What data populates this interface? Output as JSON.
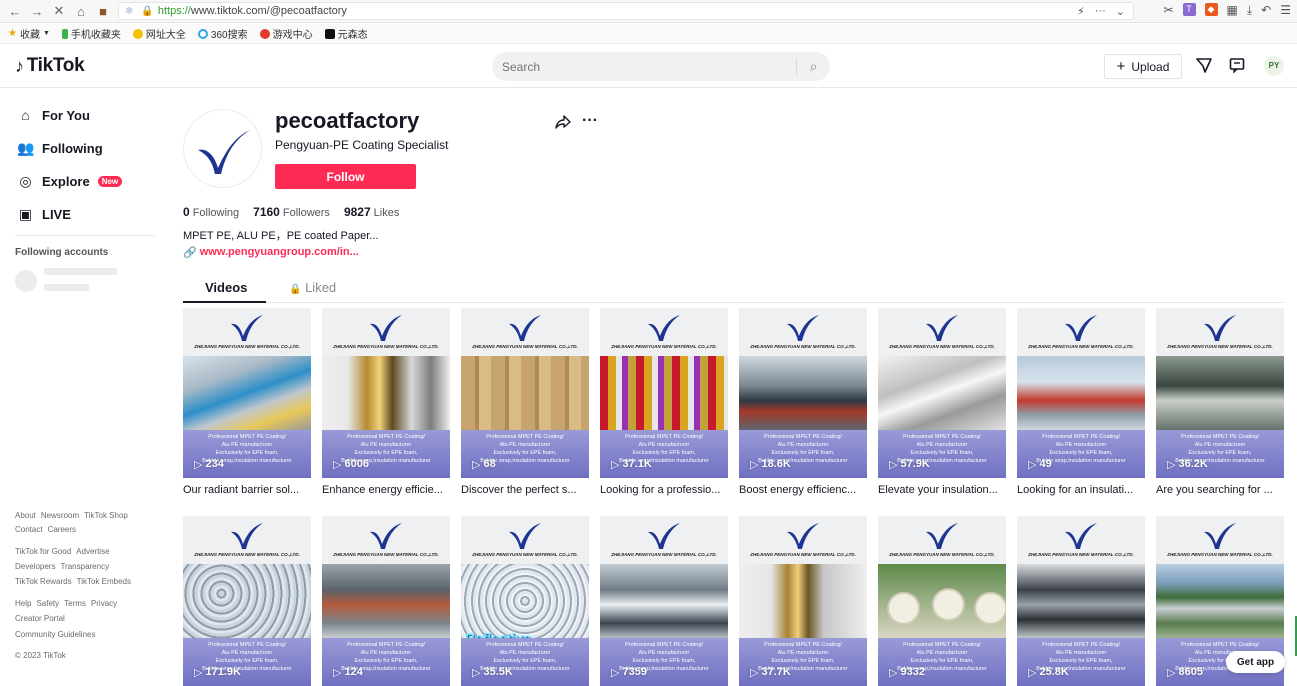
{
  "browser": {
    "url_https": "https://",
    "url_rest": "www.tiktok.com/@pecoatfactory",
    "bookmarks": [
      "收藏",
      "手机收藏夹",
      "网址大全",
      "360搜索",
      "游戏中心",
      "元森态"
    ]
  },
  "header": {
    "logo": "TikTok",
    "search_placeholder": "Search",
    "upload_label": "Upload"
  },
  "sidebar": {
    "nav": [
      {
        "label": "For You",
        "icon": "home-icon"
      },
      {
        "label": "Following",
        "icon": "users-icon"
      },
      {
        "label": "Explore",
        "icon": "compass-icon",
        "badge": "New"
      },
      {
        "label": "LIVE",
        "icon": "live-icon"
      }
    ],
    "following_title": "Following accounts",
    "footer": [
      [
        "About",
        "Newsroom",
        "TikTok Shop"
      ],
      [
        "Contact",
        "Careers"
      ],
      [
        "TikTok for Good",
        "Advertise"
      ],
      [
        "Developers",
        "Transparency"
      ],
      [
        "TikTok Rewards",
        "TikTok Embeds"
      ],
      [
        "Help",
        "Safety",
        "Terms",
        "Privacy"
      ],
      [
        "Creator Portal"
      ],
      [
        "Community Guidelines"
      ],
      [
        "© 2023 TikTok"
      ]
    ]
  },
  "profile": {
    "username": "pecoatfactory",
    "nickname": "Pengyuan-PE Coating Specialist",
    "follow_label": "Follow",
    "following_count": "0",
    "following_label": "Following",
    "followers_count": "7160",
    "followers_label": "Followers",
    "likes_count": "9827",
    "likes_label": "Likes",
    "bio": "MPET PE, ALU PE，PE coated Paper...",
    "link": "www.pengyuangroup.com/in..."
  },
  "tabs": {
    "videos": "Videos",
    "liked": "Liked"
  },
  "video_common": {
    "company": "ZHEJIANG PENGYUAN NEW MATERIAL CO.,LTD.",
    "band_line1": "Professional MPET PE Coating/",
    "band_line2": "Alu PE manufacturer",
    "band_line3": "Exclusively for EPE foam,",
    "band_line4": "Bubble wrap,Insulation manufacturer"
  },
  "videos": [
    {
      "views": "234",
      "caption": "Our radiant barrier sol...",
      "photo": "rolls"
    },
    {
      "views": "6006",
      "caption": "Enhance energy efficie...",
      "photo": "gold"
    },
    {
      "views": "68",
      "caption": "Discover the perfect s...",
      "photo": "boxes"
    },
    {
      "views": "37.1K",
      "caption": "Looking for a professio...",
      "photo": "colorful"
    },
    {
      "views": "18.6K",
      "caption": "Boost energy efficienc...",
      "photo": "machine"
    },
    {
      "views": "57.9K",
      "caption": "Elevate your insulation...",
      "photo": "silver"
    },
    {
      "views": "49",
      "caption": "Looking for an insulati...",
      "photo": "factory"
    },
    {
      "views": "36.2K",
      "caption": "Are you searching for ...",
      "photo": "line"
    },
    {
      "views": "171.9K",
      "caption": "",
      "photo": "bubble"
    },
    {
      "views": "124",
      "caption": "",
      "photo": "plant"
    },
    {
      "views": "35.5K",
      "caption": "",
      "photo": "reflective",
      "overlay1": "Reflective",
      "overlay2": "Bubble insulation"
    },
    {
      "views": "7359",
      "caption": "",
      "photo": "machine2"
    },
    {
      "views": "37.7K",
      "caption": "",
      "photo": "gold2"
    },
    {
      "views": "9332",
      "caption": "",
      "photo": "paper"
    },
    {
      "views": "25.8K",
      "caption": "",
      "photo": "rollers"
    },
    {
      "views": "8605",
      "caption": "",
      "photo": "aerial"
    }
  ],
  "get_app": "Get app"
}
